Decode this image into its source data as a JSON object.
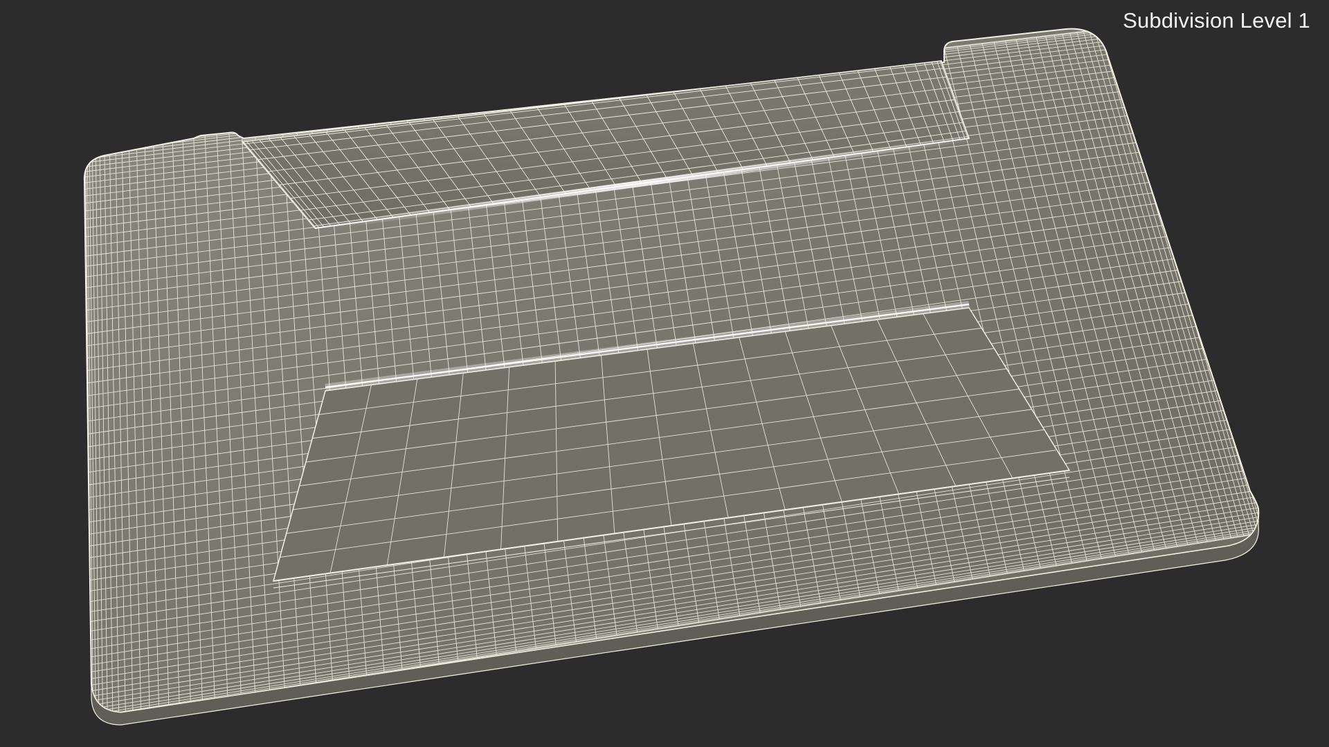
{
  "viewport": {
    "label": "Subdivision Level 1",
    "background_color": "#2c2c2c",
    "wire_color": "#f4f1e4",
    "surface_color": "#76766c"
  }
}
